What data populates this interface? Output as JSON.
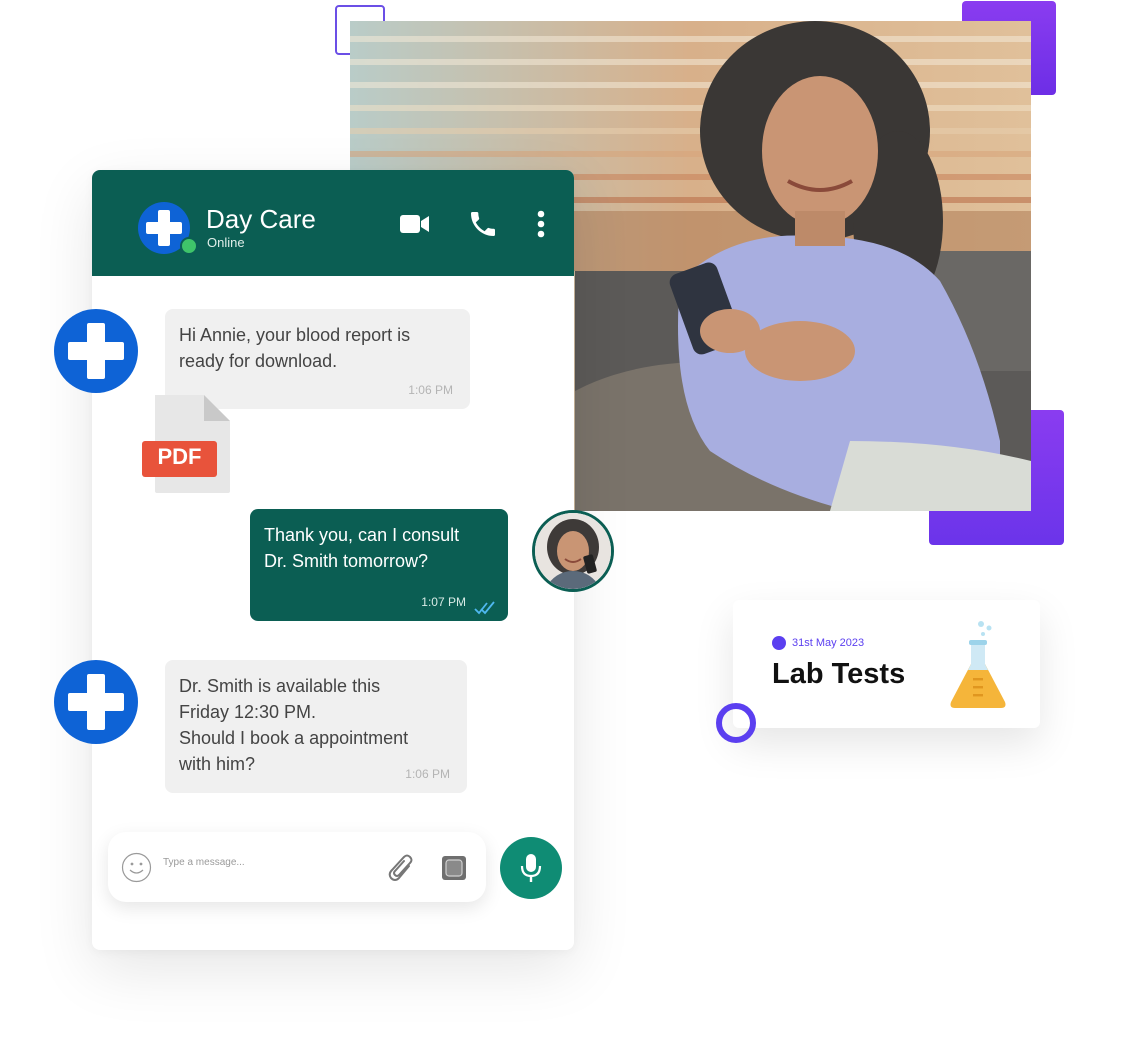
{
  "chat": {
    "header": {
      "title": "Day Care",
      "status": "Online",
      "icons": [
        "video-call-icon",
        "phone-call-icon",
        "more-vertical-icon"
      ]
    },
    "messages": [
      {
        "direction": "incoming",
        "text": "Hi Annie, your blood report is\nready for download.",
        "time": "1:06 PM"
      },
      {
        "direction": "incoming",
        "attachment": "PDF"
      },
      {
        "direction": "outgoing",
        "text": "Thank you, can I consult\nDr. Smith tomorrow?",
        "time": "1:07 PM",
        "read_icon": "double-check-icon"
      },
      {
        "direction": "incoming",
        "text": "Dr. Smith is available this\nFriday 12:30 PM.\nShould I book a appointment\nwith him?",
        "time": "1:06 PM"
      }
    ],
    "composer": {
      "placeholder": "Type a message...",
      "icons": [
        "emoji-icon",
        "paperclip-icon",
        "camera-icon",
        "microphone-icon"
      ]
    }
  },
  "lab_card": {
    "date": "31st May 2023",
    "title": "Lab Tests",
    "icon": "flask-icon"
  },
  "colors": {
    "header_green": "#0b5e53",
    "mic_green": "#0f8c74",
    "brand_blue": "#0e63d6",
    "accent_purple": "#5b3ff0",
    "pdf_red": "#e8533b"
  }
}
